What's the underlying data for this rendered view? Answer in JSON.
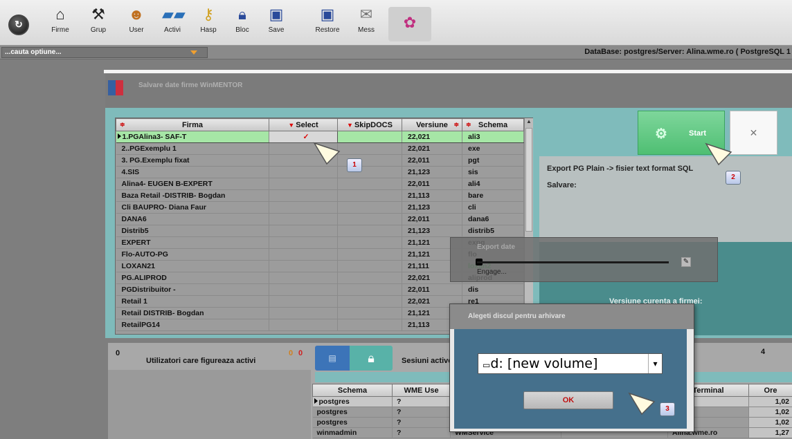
{
  "toolbar": {
    "items": [
      {
        "label": "Firme",
        "icon": "home-icon"
      },
      {
        "label": "Grup",
        "icon": "tools-icon"
      },
      {
        "label": "User",
        "icon": "users-icon"
      },
      {
        "label": "Activi",
        "icon": "activity-icon"
      },
      {
        "label": "Hasp",
        "icon": "key-icon"
      },
      {
        "label": "Bloc",
        "icon": "lock-icon"
      },
      {
        "label": "Save",
        "icon": "save-icon"
      },
      {
        "label": "Restore",
        "icon": "restore-icon"
      },
      {
        "label": "Mess",
        "icon": "message-icon"
      }
    ]
  },
  "search": {
    "value": "...cauta optiune..."
  },
  "database_info": "DataBase: postgres/Server: Alina.wme.ro ( PostgreSQL 1",
  "panel": {
    "title": "Salvare date firme WinMENTOR"
  },
  "grid": {
    "headers": {
      "firma": "Firma",
      "select": "Select",
      "skipdocs": "SkipDOCS",
      "versiune": "Versiune",
      "schema": "Schema"
    },
    "rows": [
      {
        "firma": "1.PGAlina3- SAF-T",
        "select": "✓",
        "versiune": "22,021",
        "schema": "ali3"
      },
      {
        "firma": "2..PGExemplu 1",
        "select": "",
        "versiune": "22,021",
        "schema": "exe"
      },
      {
        "firma": "3. PG.Exemplu fixat",
        "select": "",
        "versiune": "22,011",
        "schema": "pgt"
      },
      {
        "firma": "4.SIS",
        "select": "",
        "versiune": "21,123",
        "schema": "sis"
      },
      {
        "firma": "Alina4- EUGEN B-EXPERT",
        "select": "",
        "versiune": "22,011",
        "schema": "ali4"
      },
      {
        "firma": "Baza Retail -DISTRIB- Bogdan",
        "select": "",
        "versiune": "21,113",
        "schema": "bare"
      },
      {
        "firma": "Cli BAUPRO- Diana Faur",
        "select": "",
        "versiune": "21,123",
        "schema": "cli"
      },
      {
        "firma": "DANA6",
        "select": "",
        "versiune": "22,011",
        "schema": "dana6"
      },
      {
        "firma": "Distrib5",
        "select": "",
        "versiune": "21,123",
        "schema": "distrib5"
      },
      {
        "firma": "EXPERT",
        "select": "",
        "versiune": "21,121",
        "schema": "expg"
      },
      {
        "firma": "Flo-AUTO-PG",
        "select": "",
        "versiune": "21,121",
        "schema": "flo"
      },
      {
        "firma": "LOXAN21",
        "select": "",
        "versiune": "21,111",
        "schema": "loxan2"
      },
      {
        "firma": "PG.ALIPROD",
        "select": "",
        "versiune": "22,021",
        "schema": "aliprod"
      },
      {
        "firma": "PGDistribuitor -",
        "select": "",
        "versiune": "22,011",
        "schema": "dis"
      },
      {
        "firma": "Retail 1",
        "select": "",
        "versiune": "22,021",
        "schema": "re1"
      },
      {
        "firma": "Retail DISTRIB- Bogdan",
        "select": "",
        "versiune": "21,121",
        "schema": ""
      },
      {
        "firma": "RetailPG14",
        "select": "",
        "versiune": "21,113",
        "schema": ""
      }
    ]
  },
  "start": {
    "label": "Start"
  },
  "export": {
    "line1": "Export PG Plain -> fisier text format SQL",
    "line2": "Salvare:"
  },
  "versiune_curenta": "Versiune curenta a firmei:",
  "progress": {
    "title": "Export date",
    "status": "Engage..."
  },
  "users_panel": {
    "count": "0",
    "title": "Utilizatori care figureaza activi",
    "orange": "0",
    "red": "0"
  },
  "sessions_panel": {
    "title": "Sesiuni active",
    "count": "4",
    "headers": {
      "schema": "Schema",
      "wmeuser": "WME Use",
      "terminal": "Terminal",
      "ore": "Ore"
    },
    "rows": [
      {
        "schema": "postgres",
        "wmeuser": "?",
        "app": "",
        "terminal": "",
        "ore": "1,02"
      },
      {
        "schema": "postgres",
        "wmeuser": "?",
        "app": "",
        "terminal": "",
        "ore": "1,02"
      },
      {
        "schema": "postgres",
        "wmeuser": "?",
        "app": "",
        "terminal": "",
        "ore": "1,02"
      },
      {
        "schema": "winmadmin",
        "wmeuser": "?",
        "app": "WMService",
        "terminal": "Alina.wme.ro",
        "ore": "1,27"
      }
    ]
  },
  "dialog": {
    "title": "Alegeti discul pentru arhivare",
    "drive": "d: [new volume]",
    "ok": "OK"
  },
  "badges": {
    "b1": "1",
    "b2": "2",
    "b3": "3"
  }
}
